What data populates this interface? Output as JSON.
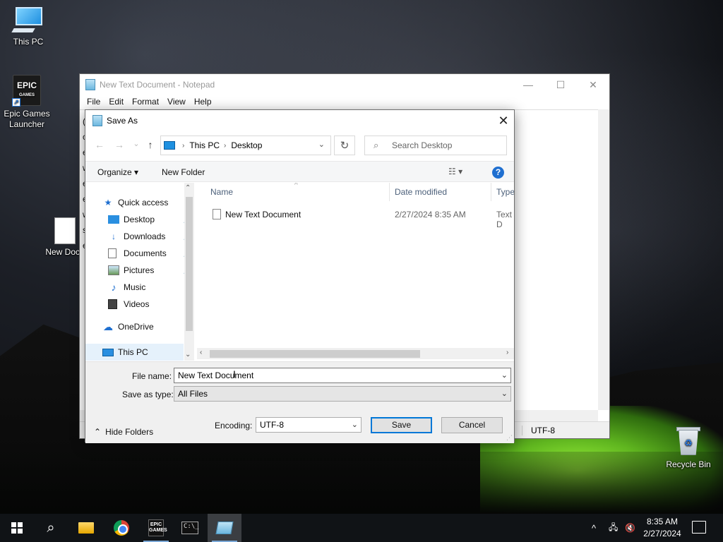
{
  "desktop": {
    "icons": [
      {
        "label": "This PC"
      },
      {
        "label": "Epic Games Launcher",
        "logo_text": "EPIC",
        "logo_sub": "GAMES"
      },
      {
        "label": "New Docu"
      },
      {
        "label": "Recycle Bin"
      }
    ]
  },
  "notepad": {
    "title": "New Text Document - Notepad",
    "menu": [
      "File",
      "Edit",
      "Format",
      "View",
      "Help"
    ],
    "status_encoding": "UTF-8",
    "partial_text": [
      "(",
      "c",
      "e",
      "w",
      "e",
      "e",
      "w",
      "s",
      "e"
    ],
    "controls": {
      "minimize": "—",
      "maximize": "☐",
      "close": "✕"
    }
  },
  "dialog": {
    "title": "Save As",
    "close_glyph": "✕",
    "nav": {
      "back": "←",
      "forward": "→",
      "recent": "⌄",
      "up": "↑"
    },
    "address": {
      "root": "This PC",
      "separator": "›",
      "current": "Desktop"
    },
    "refresh_glyph": "↻",
    "search_placeholder": "Search Desktop",
    "toolbar": {
      "organize": "Organize ▾",
      "new_folder": "New Folder",
      "views_glyph": "☷ ▾",
      "help_glyph": "?"
    },
    "nav_pane": {
      "quick_access": "Quick access",
      "items": [
        {
          "label": "Desktop",
          "icon": "desktop-icon",
          "pinned": true
        },
        {
          "label": "Downloads",
          "icon": "downloads-icon",
          "pinned": true
        },
        {
          "label": "Documents",
          "icon": "documents-icon",
          "pinned": true
        },
        {
          "label": "Pictures",
          "icon": "pictures-icon",
          "pinned": true
        },
        {
          "label": "Music",
          "icon": "music-icon",
          "pinned": false
        },
        {
          "label": "Videos",
          "icon": "videos-icon",
          "pinned": false
        }
      ],
      "onedrive": "OneDrive",
      "this_pc": "This PC"
    },
    "columns": {
      "name": "Name",
      "date": "Date modified",
      "type": "Type"
    },
    "files": [
      {
        "name": "New Text Document",
        "date": "2/27/2024 8:35 AM",
        "type": "Text D"
      }
    ],
    "file_name_label": "File name:",
    "file_name_value": "New Text Document",
    "save_as_type_label": "Save as type:",
    "save_as_type_value": "All Files",
    "encoding_label": "Encoding:",
    "encoding_value": "UTF-8",
    "save_button": "Save",
    "cancel_button": "Cancel",
    "hide_folders": "Hide Folders"
  },
  "taskbar": {
    "epic_text": "EPIC",
    "epic_sub": "GAMES",
    "cmd_text": "C:\\_",
    "clock_time": "8:35 AM",
    "clock_date": "2/27/2024",
    "tray_chevron": "^"
  },
  "colors": {
    "accent": "#0078d7",
    "selection": "#e5f1fb",
    "help": "#1f6fd0"
  }
}
